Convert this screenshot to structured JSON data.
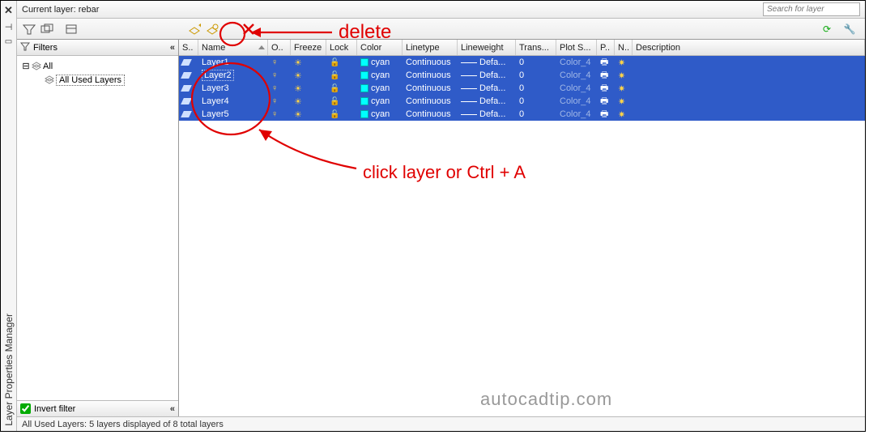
{
  "app": {
    "title": "Layer Properties Manager",
    "current_layer_label": "Current layer: rebar",
    "search_placeholder": "Search for layer"
  },
  "filters": {
    "header": "Filters",
    "root": "All",
    "child": "All Used Layers",
    "invert_label": "Invert filter"
  },
  "columns": {
    "status": "S..",
    "name": "Name",
    "on": "O..",
    "freeze": "Freeze",
    "lock": "Lock",
    "color": "Color",
    "linetype": "Linetype",
    "lineweight": "Lineweight",
    "transparency": "Trans...",
    "plotstyle": "Plot S...",
    "plot": "P..",
    "newvp": "N..",
    "description": "Description"
  },
  "rows": [
    {
      "name": "Layer1",
      "on": true,
      "freeze": false,
      "lock": false,
      "color": "cyan",
      "linetype": "Continuous",
      "lineweight": "Defa...",
      "transparency": "0",
      "plotstyle": "Color_4",
      "plot": true,
      "newvp": true
    },
    {
      "name": "Layer2",
      "on": true,
      "freeze": false,
      "lock": false,
      "color": "cyan",
      "linetype": "Continuous",
      "lineweight": "Defa...",
      "transparency": "0",
      "plotstyle": "Color_4",
      "plot": true,
      "newvp": true,
      "focused": true
    },
    {
      "name": "Layer3",
      "on": true,
      "freeze": false,
      "lock": false,
      "color": "cyan",
      "linetype": "Continuous",
      "lineweight": "Defa...",
      "transparency": "0",
      "plotstyle": "Color_4",
      "plot": true,
      "newvp": true
    },
    {
      "name": "Layer4",
      "on": true,
      "freeze": false,
      "lock": false,
      "color": "cyan",
      "linetype": "Continuous",
      "lineweight": "Defa...",
      "transparency": "0",
      "plotstyle": "Color_4",
      "plot": true,
      "newvp": true
    },
    {
      "name": "Layer5",
      "on": true,
      "freeze": false,
      "lock": false,
      "color": "cyan",
      "linetype": "Continuous",
      "lineweight": "Defa...",
      "transparency": "0",
      "plotstyle": "Color_4",
      "plot": true,
      "newvp": true
    }
  ],
  "footer": {
    "text": "All Used Layers: 5 layers displayed of 8 total layers"
  },
  "annotations": {
    "delete": "delete",
    "click": "click layer or Ctrl + A",
    "watermark": "autocadtip.com"
  }
}
